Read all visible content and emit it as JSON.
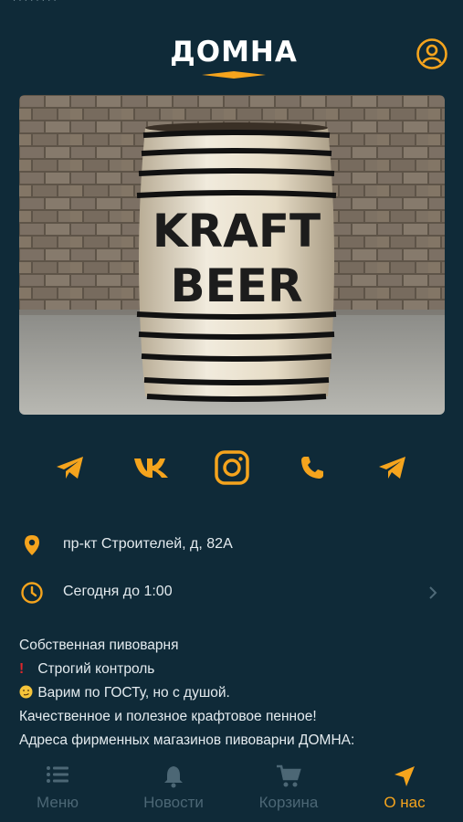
{
  "brand": {
    "name": "ДОМНА",
    "accent": "#f5a41d",
    "background": "#0f2a38"
  },
  "header": {
    "profile_icon": "user-circle-icon"
  },
  "hero_image": {
    "barrel_text_line1": "KRAFT",
    "barrel_text_line2": "BEER"
  },
  "socials": [
    {
      "name": "telegram",
      "icon": "telegram-icon"
    },
    {
      "name": "vk",
      "icon": "vk-icon"
    },
    {
      "name": "instagram",
      "icon": "instagram-icon"
    },
    {
      "name": "phone",
      "icon": "phone-icon"
    },
    {
      "name": "telegram",
      "icon": "telegram-icon"
    }
  ],
  "info": {
    "address": "пр-кт Строителей, д, 82А",
    "hours": "Сегодня до 1:00"
  },
  "description": {
    "line1": "Собственная пивоварня",
    "line2": "Строгий контроль",
    "line3": "Варим по ГОСТу, но с душой.",
    "line4": "Качественное и полезное крафтовое пенное!",
    "line5": "Адреса фирменных магазинов пивоварни ДОМНА:"
  },
  "tabbar": {
    "menu": "Меню",
    "news": "Новости",
    "cart": "Корзина",
    "about": "О нас",
    "active": "about"
  }
}
